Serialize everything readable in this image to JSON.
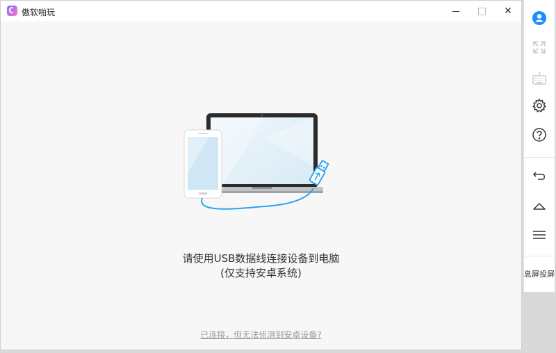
{
  "app": {
    "title": "傲软啪玩"
  },
  "main": {
    "message_line1": "请使用USB数据线连接设备到电脑",
    "message_line2": "(仅支持安卓系统)",
    "help_link": "已连接，但无法侦测到安卓设备?"
  },
  "sidebar": {
    "items": [
      {
        "icon": "user-icon"
      },
      {
        "icon": "fullscreen-icon"
      },
      {
        "icon": "keyboard-icon"
      },
      {
        "icon": "settings-icon"
      },
      {
        "icon": "help-icon"
      },
      {
        "icon": "back-icon"
      },
      {
        "icon": "home-icon"
      },
      {
        "icon": "menu-icon"
      }
    ],
    "screen_off_label": "息屏投屏"
  },
  "colors": {
    "accent": "#1a8cff",
    "cable": "#2aa6ef"
  }
}
